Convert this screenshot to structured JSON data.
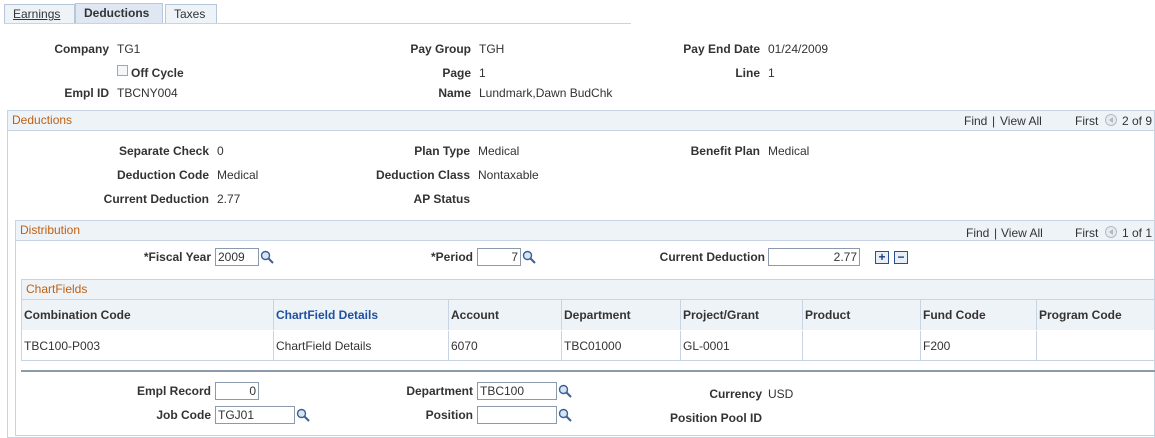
{
  "tabs": [
    {
      "label": "Earnings",
      "active": false
    },
    {
      "label": "Deductions",
      "active": true
    },
    {
      "label": "Taxes",
      "active": false
    }
  ],
  "header": {
    "company_label": "Company",
    "company": "TG1",
    "pay_group_label": "Pay Group",
    "pay_group": "TGH",
    "pay_end_date_label": "Pay End Date",
    "pay_end_date": "01/24/2009",
    "off_cycle_label": "Off Cycle",
    "off_cycle_checked": false,
    "page_label": "Page",
    "page": "1",
    "line_label": "Line",
    "line": "1",
    "empl_id_label": "Empl ID",
    "empl_id": "TBCNY004",
    "name_label": "Name",
    "name": "Lundmark,Dawn BudChk"
  },
  "deductions": {
    "title": "Deductions",
    "find": "Find",
    "sep": "|",
    "view_all": "View All",
    "first": "First",
    "pager": "2 of 9",
    "separate_check_label": "Separate Check",
    "separate_check": "0",
    "plan_type_label": "Plan Type",
    "plan_type": "Medical",
    "benefit_plan_label": "Benefit Plan",
    "benefit_plan": "Medical",
    "deduction_code_label": "Deduction Code",
    "deduction_code": "Medical",
    "deduction_class_label": "Deduction Class",
    "deduction_class": "Nontaxable",
    "current_deduction_label": "Current Deduction",
    "current_deduction": "2.77",
    "ap_status_label": "AP Status"
  },
  "distribution": {
    "title": "Distribution",
    "find": "Find",
    "sep": "|",
    "view_all": "View All",
    "first": "First",
    "pager": "1 of 1",
    "fiscal_year_label": "*Fiscal Year",
    "fiscal_year": "2009",
    "period_label": "*Period",
    "period": "7",
    "current_deduction_label": "Current Deduction",
    "current_deduction": "2.77",
    "add_symbol": "+",
    "remove_symbol": "−"
  },
  "chartfields": {
    "title": "ChartFields",
    "columns": [
      "Combination Code",
      "ChartField Details",
      "Account",
      "Department",
      "Project/Grant",
      "Product",
      "Fund Code",
      "Program Code"
    ],
    "row": [
      "TBC100-P003",
      "ChartField Details",
      "6070",
      "TBC01000",
      "GL-0001",
      "",
      "F200",
      ""
    ]
  },
  "footer": {
    "empl_record_label": "Empl Record",
    "empl_record": "0",
    "department_label": "Department",
    "department": "TBC100",
    "currency_label": "Currency",
    "currency": "USD",
    "job_code_label": "Job Code",
    "job_code": "TGJ01",
    "position_label": "Position",
    "position": "",
    "position_pool_label": "Position Pool ID"
  },
  "icons": {
    "lookup": "magnifier-icon",
    "prev": "previous-arrow-icon",
    "checkbox": "checkbox-icon"
  }
}
